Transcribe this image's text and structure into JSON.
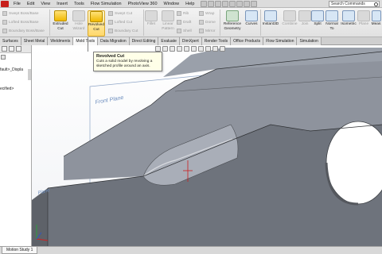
{
  "menu": {
    "items": [
      "File",
      "Edit",
      "View",
      "Insert",
      "Tools",
      "Flow Simulation",
      "PhotoView 360",
      "Window",
      "Help"
    ]
  },
  "search": {
    "value": "Search Commands"
  },
  "ribbon": {
    "features_small": [
      "Swept Boss/Base",
      "Lofted Boss/Base",
      "Boundary Boss/Base"
    ],
    "extruded_cut": "Extruded Cut",
    "hole_wizard": "Hole Wizard",
    "revolved_cut": "Revolved Cut",
    "cut_small": [
      "Swept Cut",
      "Lofted Cut",
      "Boundary Cut"
    ],
    "fillet": "Fillet",
    "linear_pattern": "Linear Pattern",
    "features_more": [
      "Rib",
      "Draft",
      "Shell"
    ],
    "features_more2": [
      "Wrap",
      "Dome",
      "Mirror"
    ],
    "reference_geometry": "Reference Geometry",
    "curves": "Curves",
    "instant3d": "Instant3D",
    "combine": "Combine",
    "join": "Join",
    "split": "Split",
    "normal_to": "Normal To",
    "isometric": "Isometric",
    "plane": "Plane",
    "measure": "Meas"
  },
  "tabs": [
    "Surfaces",
    "Sheet Metal",
    "Weldments",
    "Mold Tools",
    "Data Migration",
    "Direct Editing",
    "Evaluate",
    "DimXpert",
    "Render Tools",
    "Office Products",
    "Flow Simulation",
    "Simulation"
  ],
  "active_tab": "Mold Tools",
  "tooltip": {
    "title": "Revolved Cut",
    "description": "Cuts a solid model by revolving a sketched profile around an axis."
  },
  "left_panel": {
    "tree_lines": [
      "fault>_Displa",
      "ecified>"
    ]
  },
  "viewport": {
    "plane_labels": [
      "Front Plane",
      "Plane"
    ]
  },
  "bottom": {
    "motion_tab": "Motion Study 1"
  },
  "colors": {
    "part_top": "#8e939d",
    "part_front": "#6e737c",
    "part_side": "#5e6269",
    "plane_outline": "#8ea5c7",
    "highlight": "#f0b800"
  },
  "icons": [
    "solidworks-logo",
    "search-icon",
    "filter-icon",
    "revolved-cut-icon",
    "view-orientation-icon",
    "triad-icon"
  ]
}
